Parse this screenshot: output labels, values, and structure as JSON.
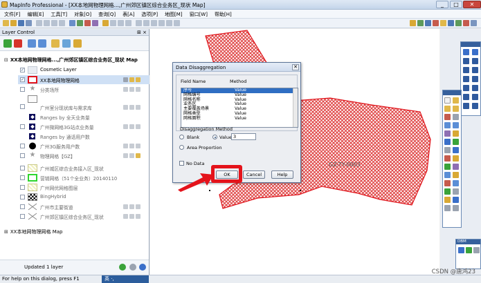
{
  "window": {
    "title": "MapInfo Professional - [XX本地网物理网格...,广州郊区镇区综合业务区_现状 Map]",
    "minimize": "_",
    "restore": "□",
    "close": "✕"
  },
  "menu": [
    "文件[F]",
    "编辑[E]",
    "工具[T]",
    "对象[O]",
    "查询[Q]",
    "表[A]",
    "选项[P]",
    "地图[M]",
    "窗口[W]",
    "帮助[H]"
  ],
  "layer_control": {
    "title": "Layer Control",
    "pin": "⊞ ×",
    "map1": "XX本地网物理网格...,广州郊区镇区综合业务区_现状 Map",
    "map2": "XX本地网物理网格 Map",
    "expand_open": "⊟",
    "expand_closed": "⊞",
    "layers": [
      {
        "name": "Cosmetic Layer",
        "checked": true,
        "selected": false
      },
      {
        "name": "XX本地网物理网格",
        "checked": true,
        "selected": true
      },
      {
        "name": "分类场所",
        "checked": false,
        "selected": false
      },
      {
        "name": "广州室分现状库与需求库",
        "checked": false,
        "selected": false
      },
      {
        "name": "Ranges by 全天业务量",
        "checked": false,
        "selected": false
      },
      {
        "name": "广州微网格3G站点业务量",
        "checked": false,
        "selected": false
      },
      {
        "name": "Ranges by 通话用户数",
        "checked": false,
        "selected": false
      },
      {
        "name": "广州3G服务用户数",
        "checked": false,
        "selected": false
      },
      {
        "name": "物理网格【GZ】",
        "checked": false,
        "selected": false
      },
      {
        "name": "广州城区综合业务接入区_现状",
        "checked": false,
        "selected": false
      },
      {
        "name": "营销网格（51个全业务）20140110",
        "checked": false,
        "selected": false
      },
      {
        "name": "广州网优网格图层",
        "checked": false,
        "selected": false
      },
      {
        "name": "BingHybrid",
        "checked": false,
        "selected": false
      },
      {
        "name": "广州市主要街道",
        "checked": false,
        "selected": false
      },
      {
        "name": "广州郊区镇区综合业务区_现状",
        "checked": false,
        "selected": false
      }
    ],
    "footer": "Updated 1 layer"
  },
  "dialog": {
    "title": "Data Disaggregation",
    "close": "✕",
    "col_field": "Field Name",
    "col_method": "Method",
    "fields": [
      {
        "name": "序号",
        "method": "Value"
      },
      {
        "name": "网格编号",
        "method": "Value"
      },
      {
        "name": "网格名称",
        "method": "Value"
      },
      {
        "name": "业务区",
        "method": "Value"
      },
      {
        "name": "主要覆盖场景",
        "method": "Value"
      },
      {
        "name": "网格类型",
        "method": "Value"
      },
      {
        "name": "网格面积",
        "method": "Value"
      }
    ],
    "method_group": "Disaggregation Method",
    "opt_blank": "Blank",
    "opt_value": "Value:",
    "value": "3",
    "opt_area": "Area Proportion",
    "no_data": "No Data",
    "ok": "OK",
    "cancel": "Cancel",
    "help": "Help"
  },
  "map": {
    "region_label": "GZ-TY-0003",
    "fill_color": "#e04646"
  },
  "palette_dbm": "DBM",
  "status": {
    "text": "For help on this dialog, press F1",
    "ime": "英 ·,",
    "watermark": "CSDN @唐鸿23"
  }
}
